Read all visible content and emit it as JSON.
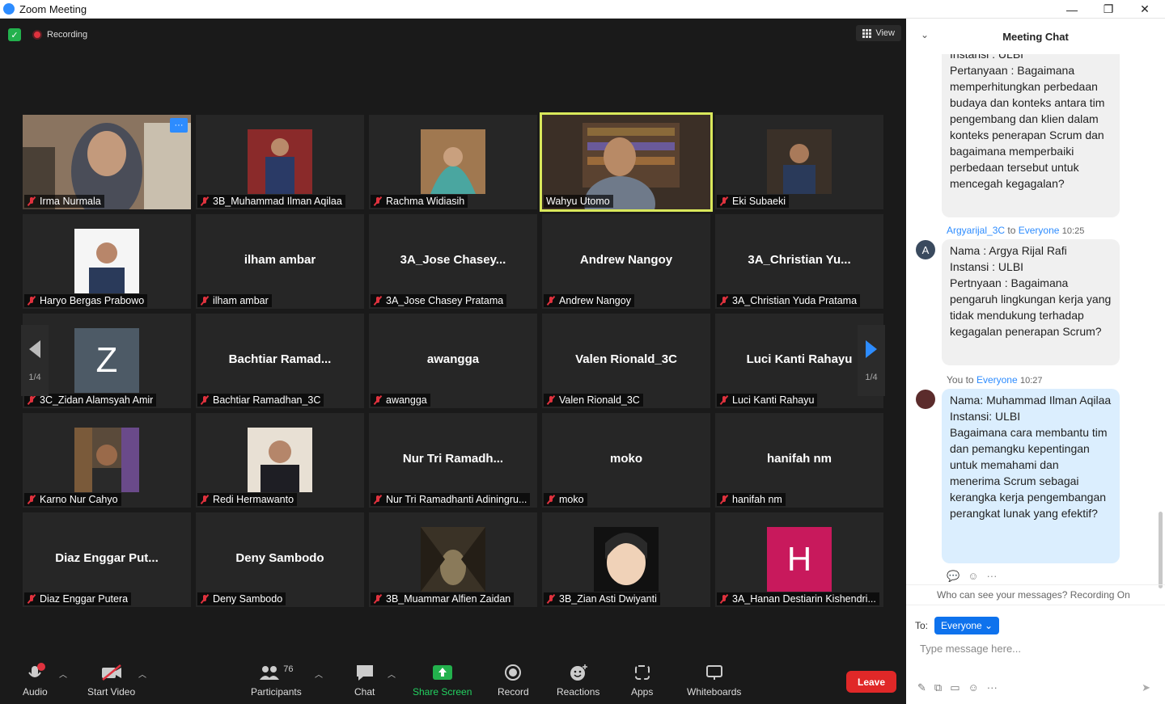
{
  "window": {
    "title": "Zoom Meeting",
    "minimize": "—",
    "maximize": "❐",
    "close": "✕"
  },
  "topbar": {
    "recording_label": "Recording",
    "view_label": "View"
  },
  "tiles": [
    {
      "name": "Irma Nurmala",
      "type": "video",
      "more_label": "···"
    },
    {
      "name": "3B_Muhammad Ilman Aqilaa",
      "type": "photo"
    },
    {
      "name": "Rachma Widiasih",
      "type": "photo"
    },
    {
      "name": "Wahyu Utomo",
      "type": "video"
    },
    {
      "name": "Eki Subaeki",
      "type": "photo"
    },
    {
      "name": "Haryo Bergas Prabowo",
      "type": "photo"
    },
    {
      "name": "ilham ambar",
      "big": "ilham ambar"
    },
    {
      "name": "3A_Jose Chasey Pratama",
      "big": "3A_Jose  Chasey..."
    },
    {
      "name": "Andrew Nangoy",
      "big": "Andrew Nangoy"
    },
    {
      "name": "3A_Christian Yuda Pratama",
      "big": "3A_Christian  Yu..."
    },
    {
      "name": "3C_Zidan Alamsyah Amir",
      "type": "letter",
      "letter": "Z"
    },
    {
      "name": "Bachtiar Ramadhan_3C",
      "big": "Bachtiar  Ramad..."
    },
    {
      "name": "awangga",
      "big": "awangga"
    },
    {
      "name": "Valen Rionald_3C",
      "big": "Valen Rionald_3C"
    },
    {
      "name": "Luci Kanti Rahayu",
      "big": "Luci Kanti Rahayu"
    },
    {
      "name": "Karno Nur Cahyo",
      "type": "photo"
    },
    {
      "name": "Redi Hermawanto",
      "type": "photo"
    },
    {
      "name": "Nur Tri Ramadhanti Adiningru...",
      "big": "Nur  Tri  Ramadh..."
    },
    {
      "name": "moko",
      "big": "moko"
    },
    {
      "name": "hanifah nm",
      "big": "hanifah nm"
    },
    {
      "name": "Diaz Enggar Putera",
      "big": "Diaz  Enggar  Put..."
    },
    {
      "name": "Deny Sambodo",
      "big": "Deny Sambodo"
    },
    {
      "name": "3B_Muammar Alfien Zaidan",
      "type": "photo"
    },
    {
      "name": "3B_Zian Asti Dwiyanti",
      "type": "photo"
    },
    {
      "name": "3A_Hanan Destiarin Kishendri...",
      "type": "letter",
      "letter": "H"
    }
  ],
  "pager": {
    "left_page": "1/4",
    "right_page": "1/4"
  },
  "toolbar": {
    "audio": "Audio",
    "audio_badge": "!",
    "start_video": "Start Video",
    "participants": "Participants",
    "participants_count": "76",
    "chat": "Chat",
    "share_screen": "Share Screen",
    "record": "Record",
    "reactions": "Reactions",
    "apps": "Apps",
    "whiteboards": "Whiteboards",
    "leave": "Leave"
  },
  "chat": {
    "title": "Meeting Chat",
    "messages": [
      {
        "text": "Instansi : ULBI\nPertanyaan : Bagaimana memperhitungkan perbedaan budaya dan konteks antara tim pengembang dan klien dalam konteks penerapan Scrum dan bagaimana memperbaiki perbedaan tersebut untuk mencegah kegagalan?"
      },
      {
        "from": "Argyarijal_3C",
        "to_word": "to",
        "to": "Everyone",
        "time": "10:25",
        "avatar": "A",
        "text": "Nama : Argya Rijal Rafi\nInstansi : ULBI\nPertnyaan : Bagaimana pengaruh lingkungan kerja yang tidak mendukung terhadap kegagalan penerapan Scrum?"
      },
      {
        "from": "You",
        "to_word": "to",
        "to": "Everyone",
        "time": "10:27",
        "text": "Nama: Muhammad Ilman Aqilaa\nInstansi: ULBI\nBagaimana cara membantu tim dan pemangku kepentingan untuk memahami dan menerima Scrum sebagai kerangka kerja pengembangan perangkat lunak yang efektif?"
      }
    ],
    "who_can_see": "Who can see your messages? Recording On",
    "to_label": "To:",
    "to_value": "Everyone",
    "input_placeholder": "Type message here..."
  }
}
